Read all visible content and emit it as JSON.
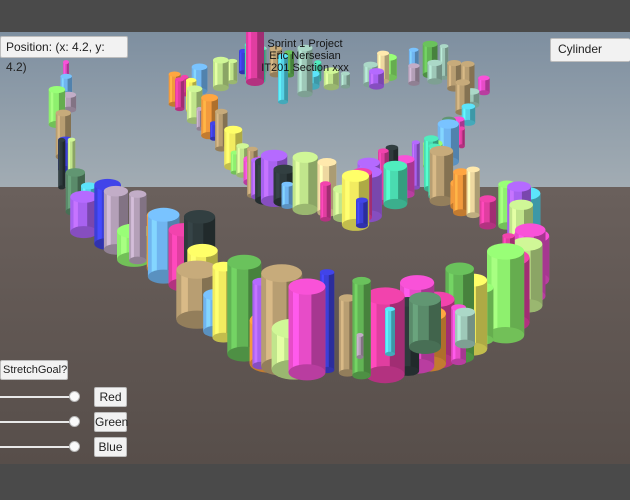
{
  "hud": {
    "position_text": "Position: (x: 4.2, y: 4.2)",
    "title_lines": [
      "Sprint 1 Project",
      "Eric Nersesian",
      "IT201 Section xxx"
    ],
    "shape_selected": "Cylinder",
    "stretch_goal_label": "StretchGoal?"
  },
  "color_sliders": [
    {
      "label": "Red",
      "value": 1.0
    },
    {
      "label": "Green",
      "value": 1.0
    },
    {
      "label": "Blue",
      "value": 1.0
    }
  ],
  "scene": {
    "sky_color": "#8d9caa",
    "ground_color": "#5d5450",
    "object_type": "cylinder",
    "palette": [
      "#e74cc8",
      "#8ef06e",
      "#55d3e8",
      "#c1e58c",
      "#f29a3c",
      "#a862f0",
      "#5a8b6a",
      "#f2ec60",
      "#3c3fd8",
      "#eed8a0",
      "#70b5f0",
      "#e03ea0",
      "#9ec8b8",
      "#b89e72",
      "#4adbb0",
      "#2e3a3c",
      "#b4a0b8",
      "#62b455"
    ]
  }
}
